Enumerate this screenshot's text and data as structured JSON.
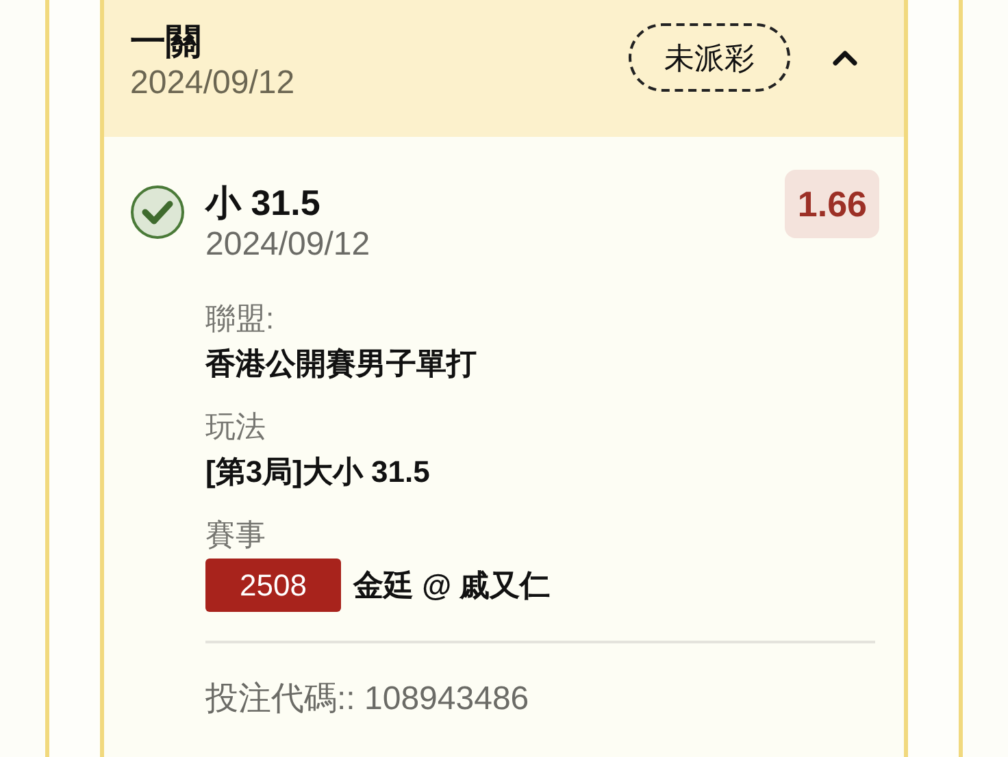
{
  "header": {
    "title": "一關",
    "date": "2024/09/12",
    "status": "未派彩",
    "expanded": true
  },
  "bet": {
    "checked": true,
    "selection": "小 31.5",
    "date": "2024/09/12",
    "odds": "1.66",
    "fields": [
      {
        "label": "聯盟:",
        "value": "香港公開賽男子單打"
      },
      {
        "label": "玩法",
        "value": "[第3局]大小 31.5"
      },
      {
        "label": "賽事",
        "match_no": "2508",
        "value": "金廷 @ 戚又仁"
      }
    ],
    "bet_code": "投注代碼:: 108943486"
  }
}
